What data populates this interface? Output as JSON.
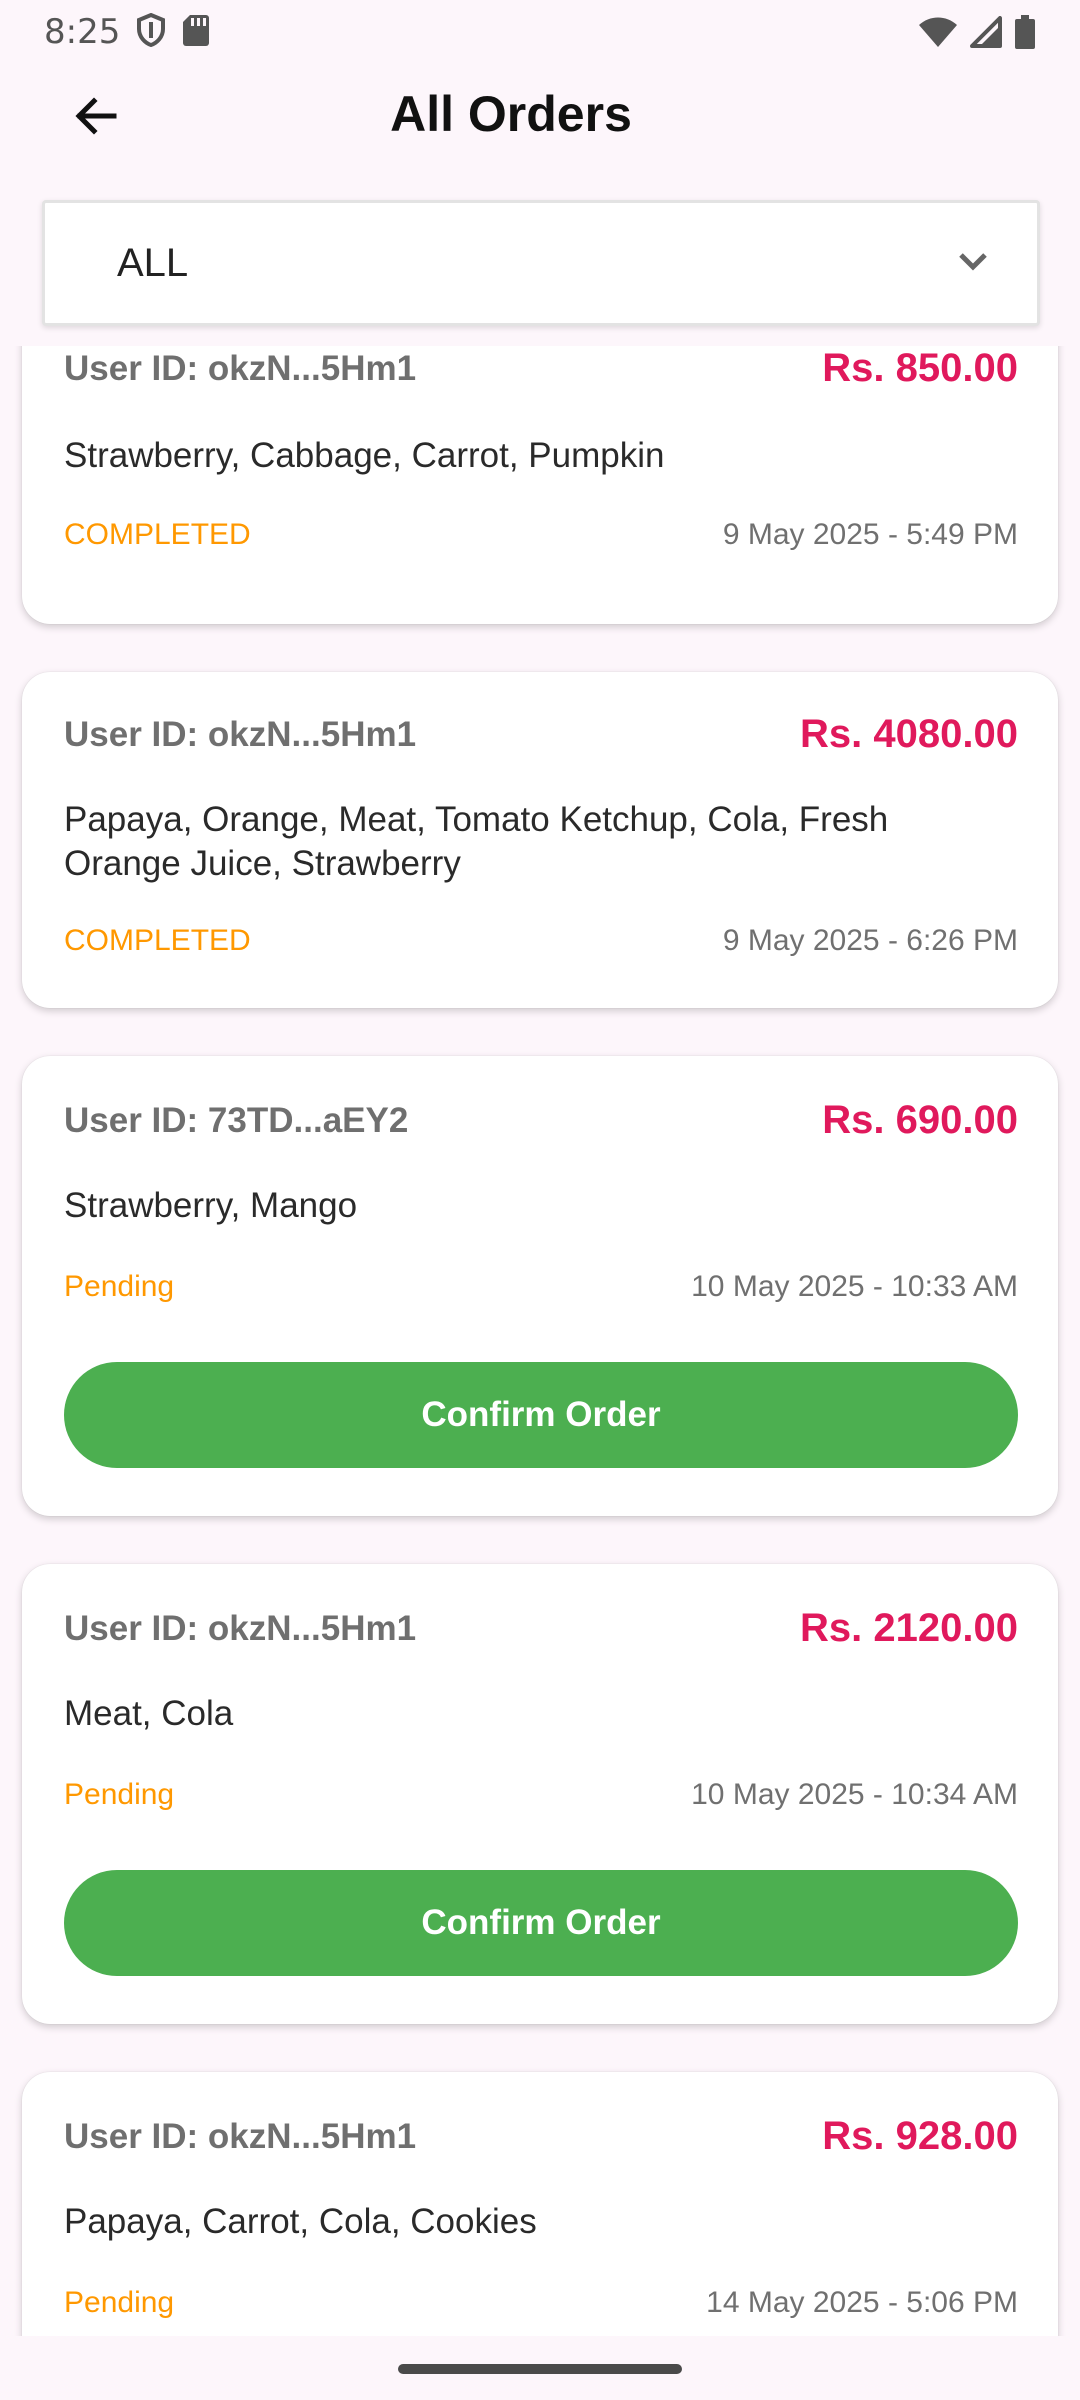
{
  "status_bar": {
    "time": "8:25",
    "icons": [
      "shield-icon",
      "sim-card-icon",
      "wifi-icon",
      "signal-icon",
      "battery-icon"
    ]
  },
  "app_bar": {
    "back_icon": "arrow-back-icon",
    "title": "All Orders"
  },
  "filter": {
    "selected": "ALL",
    "icon": "chevron-down-icon"
  },
  "colors": {
    "amount": "#e0195c",
    "status": "#ff9800",
    "confirm_button": "#4caf50",
    "background": "#fdf6fb"
  },
  "orders": [
    {
      "user_id": "User ID: okzN...5Hm1",
      "amount": "Rs. 850.00",
      "items": "Strawberry, Cabbage, Carrot, Pumpkin",
      "status": "COMPLETED",
      "date": "9 May 2025 - 5:49 PM"
    },
    {
      "user_id": "User ID: okzN...5Hm1",
      "amount": "Rs. 4080.00",
      "items": "Papaya, Orange, Meat, Tomato Ketchup, Cola, Fresh Orange Juice, Strawberry",
      "status": "COMPLETED",
      "date": "9 May 2025 - 6:26 PM"
    },
    {
      "user_id": "User ID: 73TD...aEY2",
      "amount": "Rs. 690.00",
      "items": "Strawberry, Mango",
      "status": "Pending",
      "date": "10 May 2025 - 10:33 AM",
      "action": "Confirm Order"
    },
    {
      "user_id": "User ID: okzN...5Hm1",
      "amount": "Rs. 2120.00",
      "items": "Meat, Cola",
      "status": "Pending",
      "date": "10 May 2025 - 10:34 AM",
      "action": "Confirm Order"
    },
    {
      "user_id": "User ID: okzN...5Hm1",
      "amount": "Rs. 928.00",
      "items": "Papaya, Carrot, Cola, Cookies",
      "status": "Pending",
      "date": "14 May 2025 - 5:06 PM"
    }
  ]
}
